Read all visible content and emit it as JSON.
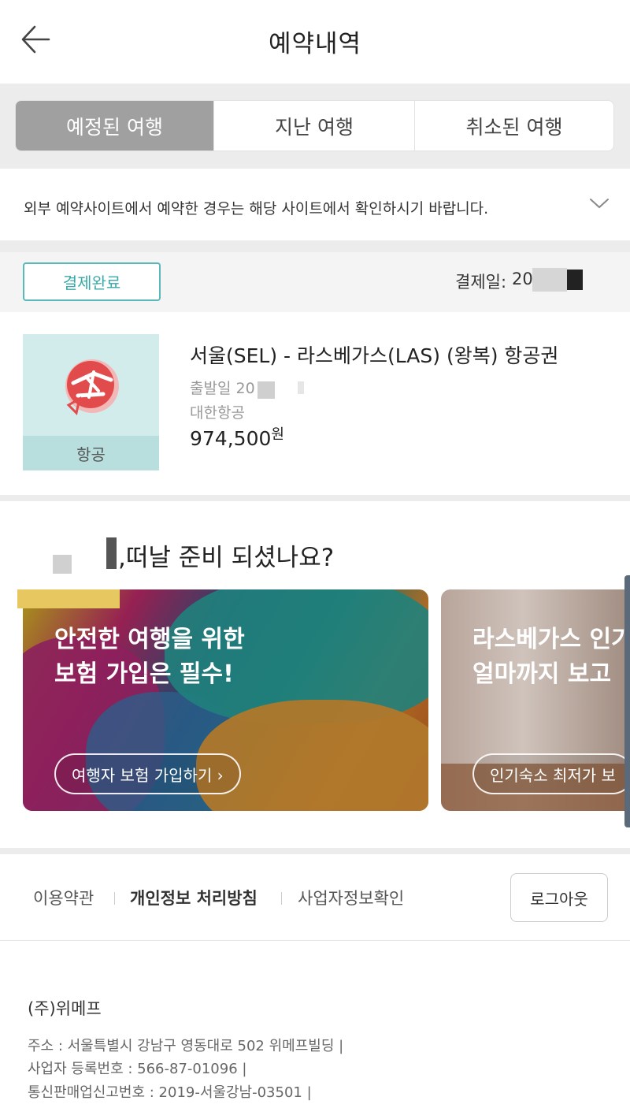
{
  "header": {
    "title": "예약내역"
  },
  "tabs": [
    {
      "label": "예정된 여행",
      "active": true
    },
    {
      "label": "지난 여행",
      "active": false
    },
    {
      "label": "취소된 여행",
      "active": false
    }
  ],
  "notice": {
    "text": "외부 예약사이트에서 예약한 경우는 해당 사이트에서 확인하시기 바랍니다."
  },
  "booking": {
    "status": "결제완료",
    "payment_date_label": "결제일:",
    "payment_date_value": "20",
    "category": "항공",
    "title": "서울(SEL) - 라스베가스(LAS) (왕복) 항공권",
    "departure": "출발일 20",
    "airline": "대한항공",
    "price": "974,500",
    "currency": "원"
  },
  "promo": {
    "title": ",떠날 준비 되셨나요?",
    "cards": [
      {
        "line1": "안전한 여행을 위한",
        "line2": "보험 가입은 필수!",
        "button": "여행자 보험 가입하기 ›"
      },
      {
        "line1": "라스베가스 인기",
        "line2": "얼마까지 보고",
        "button": "인기숙소 최저가 보"
      }
    ]
  },
  "footer": {
    "links": [
      "이용약관",
      "개인정보 처리방침",
      "사업자정보확인"
    ],
    "logout": "로그아웃",
    "company": "(주)위메프",
    "info": [
      "주소 : 서울특별시 강남구 영동대로 502 위메프빌딩 |",
      "사업자 등록번호 : 566-87-01096 |",
      "통신판매업신고번호 : 2019-서울강남-03501 |"
    ]
  },
  "colors": {
    "accent": "#3aa8a8",
    "active_tab": "#a0a0a0"
  },
  "icons": [
    "back-arrow-icon",
    "chevron-down-icon",
    "flight-ticket-icon"
  ]
}
